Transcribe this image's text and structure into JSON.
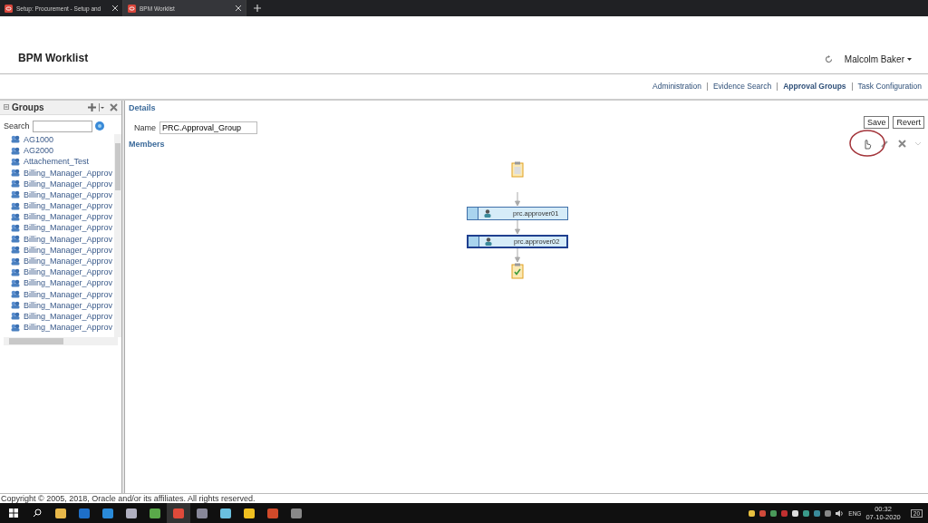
{
  "browser_tabs": [
    {
      "title": "Setup: Procurement - Setup and",
      "selected": false
    },
    {
      "title": "BPM Worklist",
      "selected": true
    }
  ],
  "header": {
    "title": "BPM Worklist",
    "user": "Malcolm Baker"
  },
  "nav_links": [
    {
      "label": "Administration",
      "selected": false
    },
    {
      "label": "Evidence Search",
      "selected": false
    },
    {
      "label": "Approval Groups",
      "selected": true
    },
    {
      "label": "Task Configuration",
      "selected": false
    }
  ],
  "groups_panel": {
    "title": "Groups",
    "search_label": "Search",
    "items": [
      "AG1000",
      "AG2000",
      "Attachement_Test",
      "Billing_Manager_Approv",
      "Billing_Manager_Approv",
      "Billing_Manager_Approv",
      "Billing_Manager_Approv",
      "Billing_Manager_Approv",
      "Billing_Manager_Approv",
      "Billing_Manager_Approv",
      "Billing_Manager_Approv",
      "Billing_Manager_Approv",
      "Billing_Manager_Approv",
      "Billing_Manager_Approv",
      "Billing_Manager_Approv",
      "Billing_Manager_Approv",
      "Billing_Manager_Approv",
      "Billing_Manager_Approv"
    ]
  },
  "details": {
    "title": "Details",
    "buttons": [
      "Save",
      "Revert"
    ],
    "name_label": "Name",
    "name_value": "PRC.Approval_Group",
    "members_title": "Members",
    "members": [
      {
        "kind": "start"
      },
      {
        "kind": "approver",
        "label": "prc.approver01",
        "selected": false
      },
      {
        "kind": "approver",
        "label": "prc.approver02",
        "selected": true
      },
      {
        "kind": "end"
      }
    ]
  },
  "footer": {
    "copyright": "Copyright © 2005, 2018, Oracle and/or its affiliates. All rights reserved."
  },
  "taskbar": {
    "language": "ENG",
    "time": "00:32",
    "date": "07-10-2020",
    "notifications": "20"
  }
}
